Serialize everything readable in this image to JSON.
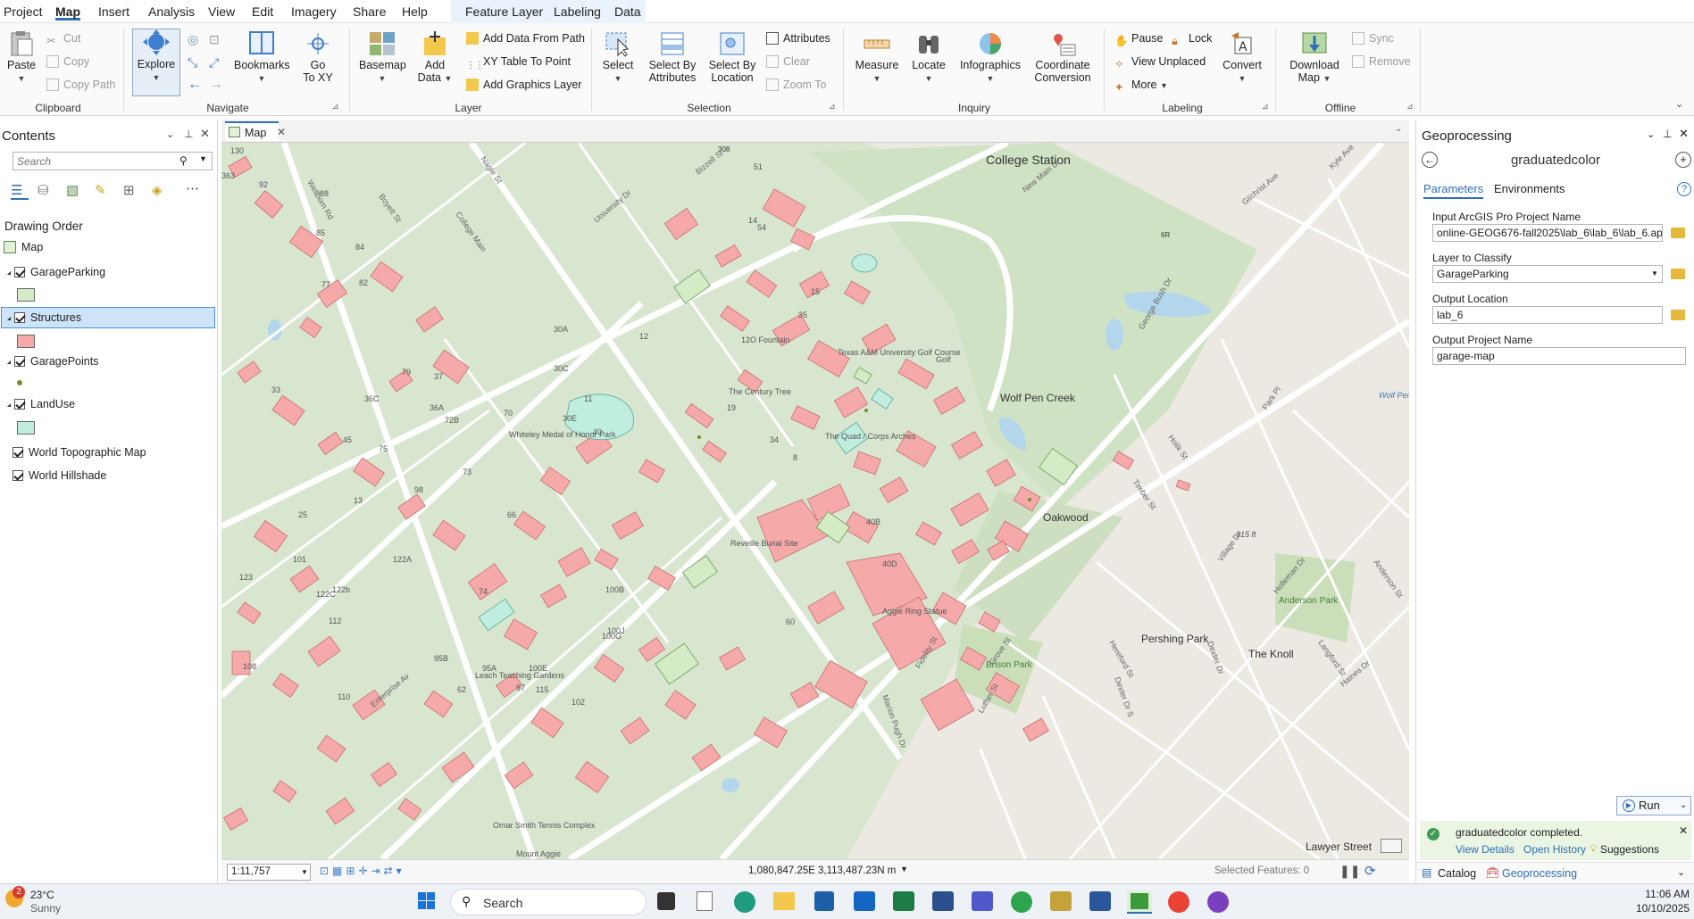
{
  "menu": {
    "items": [
      "Project",
      "Map",
      "Insert",
      "Analysis",
      "View",
      "Edit",
      "Imagery",
      "Share",
      "Help"
    ],
    "contextual": [
      "Feature Layer",
      "Labeling",
      "Data"
    ]
  },
  "ribbon": {
    "clipboard": {
      "group": "Clipboard",
      "paste": "Paste",
      "cut": "Cut",
      "copy": "Copy",
      "copy_path": "Copy Path"
    },
    "navigate": {
      "group": "Navigate",
      "explore": "Explore",
      "bookmarks": "Bookmarks",
      "goto_line1": "Go",
      "goto_line2": "To XY"
    },
    "layer": {
      "group": "Layer",
      "basemap": "Basemap",
      "add_data_line1": "Add",
      "add_data_line2": "Data",
      "add_from_path": "Add Data From Path",
      "xy_table": "XY Table To Point",
      "add_graphics": "Add Graphics Layer"
    },
    "selection": {
      "group": "Selection",
      "select": "Select",
      "select_by_attr_1": "Select By",
      "select_by_attr_2": "Attributes",
      "select_by_loc_1": "Select By",
      "select_by_loc_2": "Location",
      "attributes": "Attributes",
      "clear": "Clear",
      "zoom_to": "Zoom To"
    },
    "inquiry": {
      "group": "Inquiry",
      "measure": "Measure",
      "locate": "Locate",
      "infographics": "Infographics",
      "coord_1": "Coordinate",
      "coord_2": "Conversion"
    },
    "labeling": {
      "group": "Labeling",
      "pause": "Pause",
      "lock": "Lock",
      "view_unplaced": "View Unplaced",
      "more": "More",
      "convert": "Convert"
    },
    "offline": {
      "group": "Offline",
      "download_1": "Download",
      "download_2": "Map",
      "sync": "Sync",
      "remove": "Remove"
    }
  },
  "contents": {
    "title": "Contents",
    "search_placeholder": "Search",
    "drawing_order": "Drawing Order",
    "map": "Map",
    "layers": [
      {
        "name": "GarageParking",
        "swatch": "#d3ecc5"
      },
      {
        "name": "Structures",
        "swatch": "#f5a9a9",
        "selected": true
      },
      {
        "name": "GaragePoints",
        "swatch": "#7a8a2e"
      },
      {
        "name": "LandUse",
        "swatch": "#bfeee0"
      },
      {
        "name": "World Topographic Map"
      },
      {
        "name": "World Hillshade"
      }
    ]
  },
  "map_view": {
    "tab": "Map",
    "scale": "1:11,757",
    "coordinates": "1,080,847.25E 3,113,487.23N m",
    "selected_features": "Selected Features: 0",
    "labels": {
      "college_station": "College Station",
      "wolf_pen_creek": "Wolf Pen Creek",
      "oakwood": "Oakwood",
      "pershing_park": "Pershing Park",
      "the_knoll": "The Knoll",
      "lawyer_street": "Lawyer Street",
      "texas_am_golf": "Texas A&M University Golf Course",
      "anderson_park": "Anderson Park",
      "brison_park": "Brison Park",
      "aggie_ring": "Aggie Ring Statue",
      "leach_gardens": "Leach Teaching Gardens",
      "omar_smith": "Omar Smith Tennis Complex",
      "quad": "The Quad / Corps Arches",
      "century_tree": "The Century Tree",
      "whiteley": "Whiteley Medal of Honor Park",
      "reveille": "Reveille Burial Site",
      "elev": "315 ft",
      "mount_aggie": "Mount Aggie",
      "wolf_pen": "Wolf Pen",
      "golf": "Golf",
      "hwy": "308",
      "spur": "6R",
      "fountain": "12O Fountain",
      "nums": [
        "130",
        "88",
        "92",
        "363",
        "85",
        "84",
        "77",
        "82",
        "54",
        "51",
        "14",
        "15",
        "35",
        "30A",
        "30C",
        "30E",
        "36C",
        "36A",
        "37",
        "33",
        "45",
        "75",
        "79",
        "72B",
        "70",
        "73",
        "98",
        "13",
        "25",
        "101",
        "122A",
        "122C",
        "122b",
        "112",
        "123",
        "108",
        "110",
        "95B",
        "95A",
        "100B",
        "100G",
        "100J",
        "100E",
        "102",
        "97",
        "115",
        "74",
        "66",
        "62",
        "60",
        "40B",
        "40D",
        "34",
        "8",
        "19",
        "40",
        "11",
        "12"
      ],
      "streets": [
        "Wellborn Rd",
        "Boyett St",
        "Nagle St",
        "College Main",
        "Bizzell St",
        "University Dr",
        "New Main Dr",
        "Gilchrist Ave",
        "Kyle Ave",
        "George Bush Dr",
        "Park Pl",
        "Holik St",
        "Timber St",
        "Village Dr",
        "Holleman Dr",
        "Langford St",
        "Haines Dr",
        "Anderson St",
        "Dexter Dr",
        "Fidelity St",
        "Luther St",
        "Marion Pugh Dr",
        "Enterprise Av",
        "Grove St",
        "Hereford St",
        "Dexter Dr S"
      ]
    }
  },
  "geoprocessing": {
    "title": "Geoprocessing",
    "tool": "graduatedcolor",
    "tabs": [
      "Parameters",
      "Environments"
    ],
    "params": [
      {
        "label": "Input ArcGIS Pro Project Name",
        "value": "online-GEOG676-fall2025\\lab_6\\lab_6\\lab_6.aprx"
      },
      {
        "label": "Layer to Classify",
        "value": "GarageParking"
      },
      {
        "label": "Output Location",
        "value": "lab_6"
      },
      {
        "label": "Output Project Name",
        "value": "garage-map"
      }
    ],
    "run": "Run",
    "status": "graduatedcolor completed.",
    "view_details": "View Details",
    "open_history": "Open History",
    "suggestions": "Suggestions",
    "bottom_tabs": [
      "Catalog",
      "Geoprocessing"
    ]
  },
  "taskbar": {
    "weather_temp": "23°C",
    "weather_desc": "Sunny",
    "weather_badge": "2",
    "search": "Search",
    "time": "11:06 AM",
    "date": "10/10/2025"
  },
  "colors": {
    "accent": "#2f6fb5",
    "structure": "#f5a9a9",
    "parking": "#d3ecc5",
    "landuse": "#bfeee0",
    "campus_green": "#d9e7d0"
  }
}
